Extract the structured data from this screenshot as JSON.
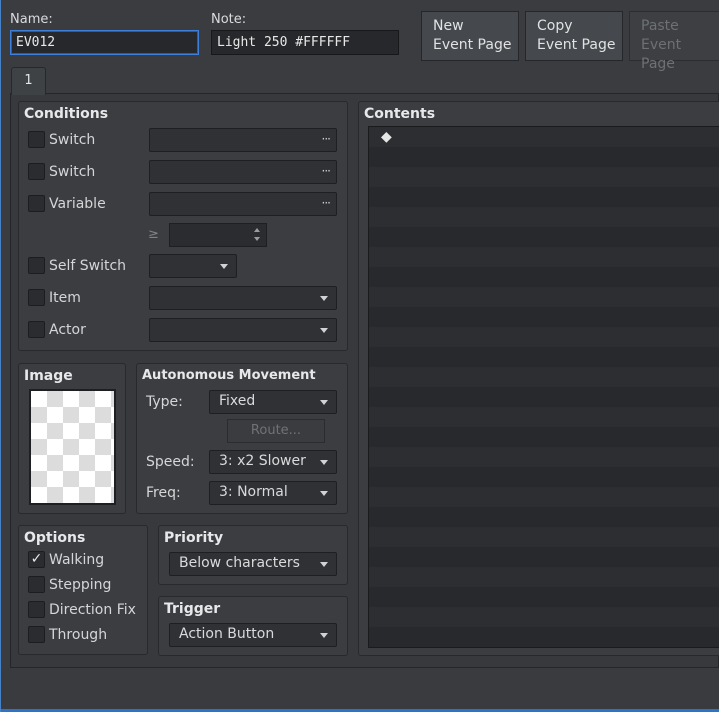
{
  "header": {
    "name_label": "Name:",
    "name_value": "EV012",
    "note_label": "Note:",
    "note_value": "Light 250 #FFFFFF",
    "new_page_line1": "New",
    "new_page_line2": "Event Page",
    "copy_page_line1": "Copy",
    "copy_page_line2": "Event Page",
    "paste_page_line1": "Paste",
    "paste_page_line2": "Event Page"
  },
  "tabs": [
    "1"
  ],
  "conditions": {
    "title": "Conditions",
    "switch1_label": "Switch",
    "switch2_label": "Switch",
    "variable_label": "Variable",
    "gte_symbol": "≥",
    "self_switch_label": "Self Switch",
    "item_label": "Item",
    "actor_label": "Actor",
    "ellipsis": "···"
  },
  "image": {
    "title": "Image"
  },
  "movement": {
    "title": "Autonomous Movement",
    "type_label": "Type:",
    "type_value": "Fixed",
    "route_button": "Route...",
    "speed_label": "Speed:",
    "speed_value": "3: x2 Slower",
    "freq_label": "Freq:",
    "freq_value": "3: Normal"
  },
  "options": {
    "title": "Options",
    "walking": "Walking",
    "walking_checked": true,
    "stepping": "Stepping",
    "direction_fix": "Direction Fix",
    "through": "Through",
    "check_mark": "✓"
  },
  "priority": {
    "title": "Priority",
    "value": "Below characters"
  },
  "trigger": {
    "title": "Trigger",
    "value": "Action Button"
  },
  "contents": {
    "title": "Contents",
    "marker": "◆"
  },
  "colors": {
    "background": "#3a3c3f",
    "field": "#26282b",
    "focus_border": "#3d7fd9",
    "list_row_a": "#2c2e31",
    "list_row_b": "#27292c"
  }
}
